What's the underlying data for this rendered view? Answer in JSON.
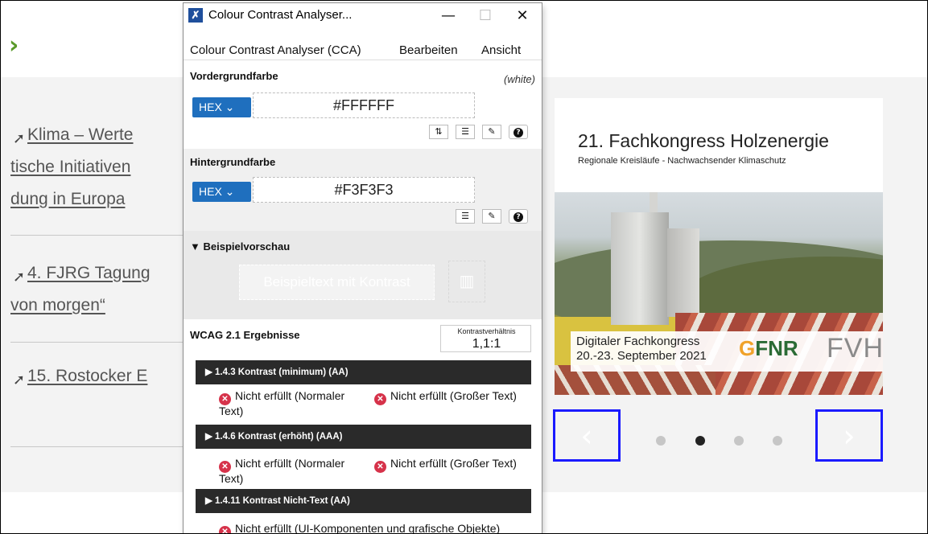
{
  "page": {
    "breadcrumb_arrow": "›",
    "links": [
      {
        "arrow": "➚",
        "line1": "Klima – Werte",
        "line2": "tische Initiativen",
        "line3": "dung in Europa"
      },
      {
        "arrow": "➚",
        "line1": "4. FJRG Tagung",
        "line2": "von morgen“"
      },
      {
        "arrow": "➚",
        "line1": "15. Rostocker E"
      }
    ],
    "event_card": {
      "title": "21. Fachkongress Holzenergie",
      "subtitle": "Regionale Kreisläufe - Nachwachsender Klimaschutz",
      "banner_line1": "Digitaler Fachkongress",
      "banner_line2": "20.-23. September 2021",
      "logo_fnr": "FNR",
      "logo_fvh": "FVH"
    },
    "carousel": {
      "prev_label": "‹",
      "next_label": "›",
      "dots": [
        false,
        true,
        false,
        false
      ]
    }
  },
  "cca": {
    "window_title": "Colour Contrast Analyser...",
    "window_buttons": {
      "minimize": "—",
      "maximize": "☐",
      "close": "✕"
    },
    "menu": [
      "Colour Contrast Analyser (CCA)",
      "Bearbeiten",
      "Ansicht"
    ],
    "foreground": {
      "title": "Vordergrundfarbe",
      "color_name": "(white)",
      "format": "HEX",
      "value": "#FFFFFF"
    },
    "background": {
      "title": "Hintergrundfarbe",
      "format": "HEX",
      "value": "#F3F3F3"
    },
    "preview": {
      "title": "▼ Beispielvorschau",
      "sample_text": "Beispieltext mit Kontrast"
    },
    "results": {
      "title": "WCAG 2.1 Ergebnisse",
      "ratio_label": "Kontrastverhältnis",
      "ratio_value": "1,1:1",
      "criteria": [
        {
          "label": "▶  1.4.3 Kontrast (minimum) (AA)",
          "normal": "Nicht erfüllt (Normaler Text)",
          "large": "Nicht erfüllt (Großer Text)"
        },
        {
          "label": "▶  1.4.6 Kontrast (erhöht) (AAA)",
          "normal": "Nicht erfüllt (Normaler Text)",
          "large": "Nicht erfüllt (Großer Text)"
        },
        {
          "label": "▶  1.4.11 Kontrast Nicht-Text (AA)",
          "ui": "Nicht erfüllt (UI-Komponenten und grafische Objekte)"
        }
      ]
    }
  },
  "colors": {
    "page_gray": "#f3f3f3",
    "accent_green": "#5a9a2a",
    "focus_outline": "#1a1aff",
    "cca_hex_button": "#1f6fbe",
    "fail_red": "#d6324a"
  }
}
